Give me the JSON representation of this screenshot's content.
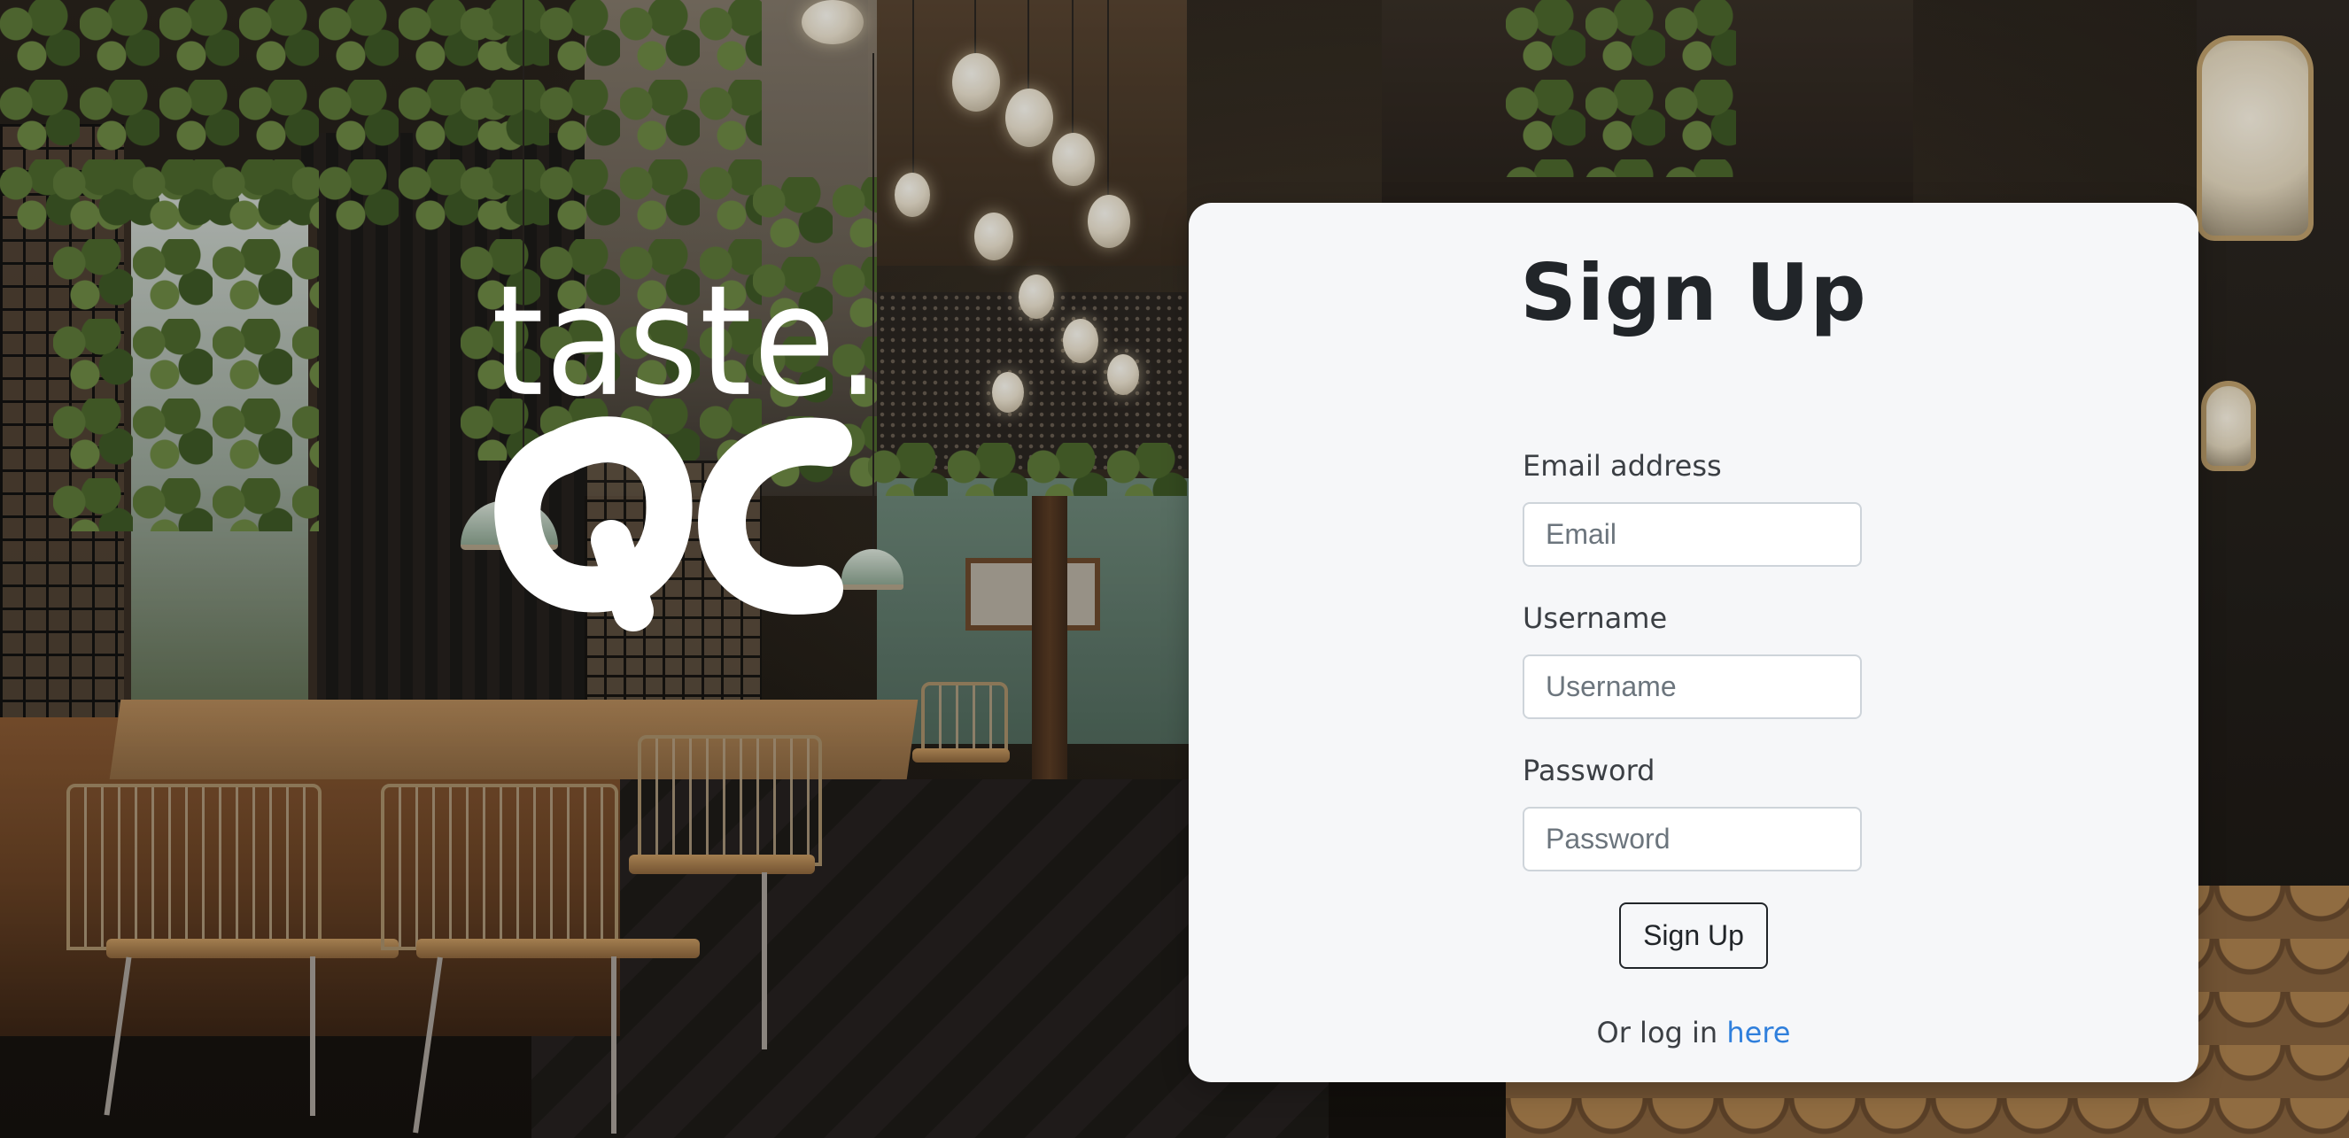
{
  "brand": {
    "logo_text": "QC",
    "tagline": "taste."
  },
  "signup": {
    "title": "Sign Up",
    "email": {
      "label": "Email address",
      "placeholder": "Email",
      "value": ""
    },
    "username": {
      "label": "Username",
      "placeholder": "Username",
      "value": ""
    },
    "password": {
      "label": "Password",
      "placeholder": "Password",
      "value": ""
    },
    "submit_label": "Sign Up",
    "login_prompt": "Or log in",
    "login_link_label": "here"
  },
  "colors": {
    "card_background": "#f6f7f9",
    "title_text": "#212529",
    "link": "#2f7fdc",
    "input_border": "#ced4da"
  }
}
